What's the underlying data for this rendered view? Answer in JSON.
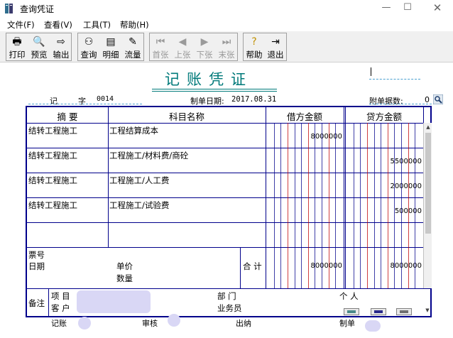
{
  "window": {
    "title": "查询凭证",
    "controls": [
      "minimize",
      "maximize",
      "close"
    ]
  },
  "menu": [
    {
      "label": "文件(F)"
    },
    {
      "label": "查看(V)"
    },
    {
      "label": "工具(T)"
    },
    {
      "label": "帮助(H)"
    }
  ],
  "toolbar": {
    "print": "打印",
    "preview": "预览",
    "export": "输出",
    "query": "查询",
    "detail": "明细",
    "flow": "流量",
    "first": "首张",
    "prev": "上张",
    "next": "下张",
    "last": "末张",
    "help": "帮助",
    "exit": "退出"
  },
  "voucher": {
    "title": "记账凭证",
    "type": "记",
    "number_label": "字",
    "number": "0014",
    "date_label": "制单日期:",
    "date": "2017.08.31",
    "attachments_label": "附单据数:",
    "attachments": "0",
    "headers": {
      "summary": "摘 要",
      "account": "科目名称",
      "debit": "借方金额",
      "credit": "贷方金额"
    },
    "rows": [
      {
        "summary": "结转工程施工",
        "account": "工程结算成本",
        "debit": "8000000",
        "credit": ""
      },
      {
        "summary": "结转工程施工",
        "account": "工程施工/材料费/商砼",
        "debit": "",
        "credit": "5500000"
      },
      {
        "summary": "结转工程施工",
        "account": "工程施工/人工费",
        "debit": "",
        "credit": "2000000"
      },
      {
        "summary": "结转工程施工",
        "account": "工程施工/试验费",
        "debit": "",
        "credit": "500000"
      },
      {
        "summary": "",
        "account": "",
        "debit": "",
        "credit": ""
      }
    ],
    "totals": {
      "ticket_no": "票号",
      "date": "日期",
      "unit_price": "单价",
      "quantity": "数量",
      "total_label": "合 计",
      "debit": "8000000",
      "credit": "8000000"
    },
    "remarks": {
      "label": "备注",
      "project": "项    目",
      "customer": "客    户",
      "department": "部    门",
      "individual": "个    人",
      "salesperson": "业务员"
    },
    "signatures": {
      "bookkeeper": "记账",
      "reviewer": "审核",
      "cashier": "出纳",
      "maker": "制单"
    }
  },
  "colors": {
    "title": "#007a7a",
    "grid": "#00008b",
    "digit_line": "#00008b",
    "unit_line": "#c00000"
  }
}
